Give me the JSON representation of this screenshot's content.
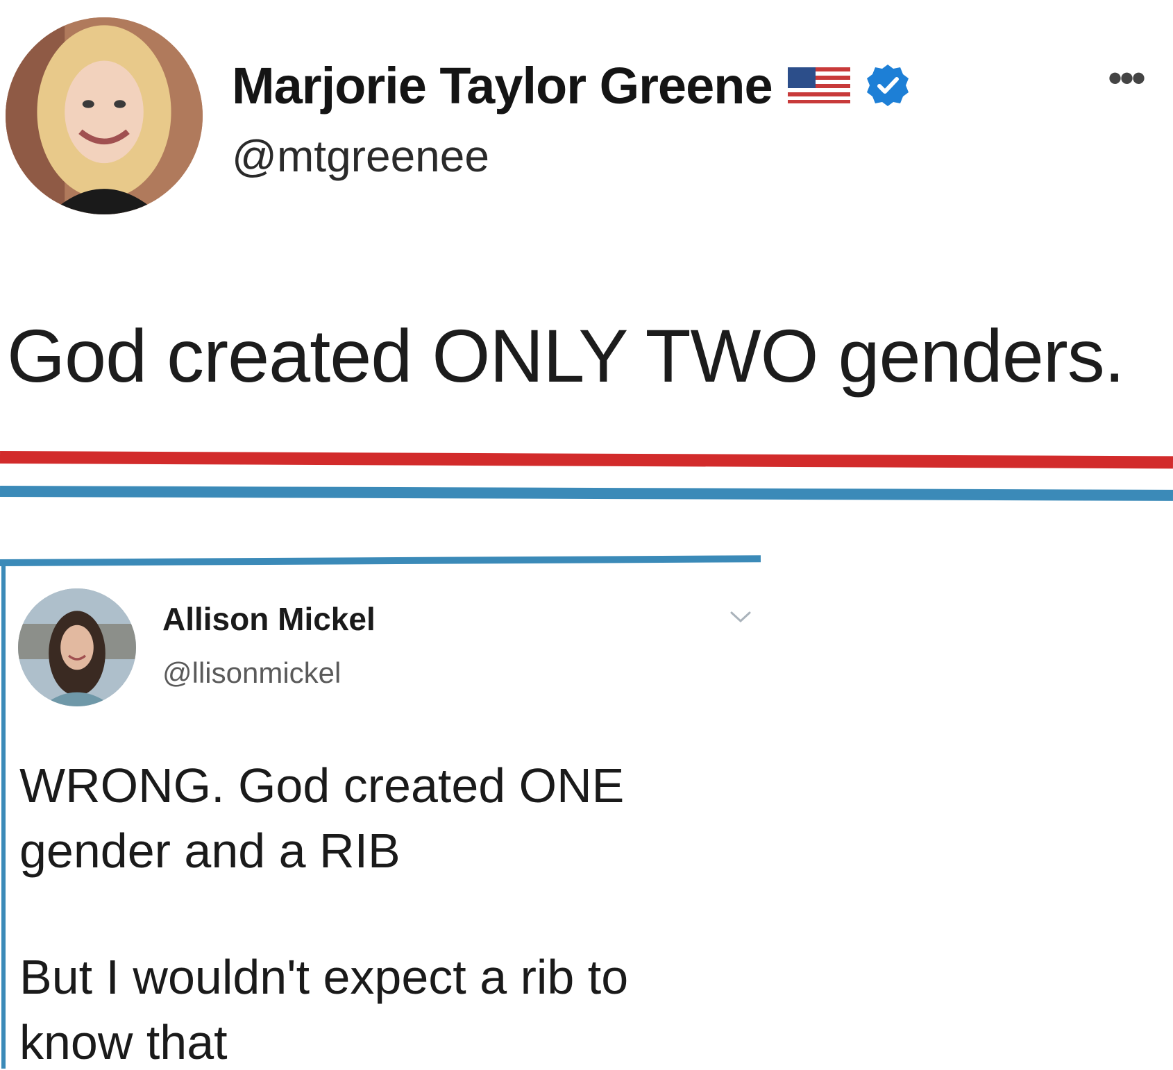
{
  "original_tweet": {
    "display_name": "Marjorie Taylor Greene",
    "handle": "@mtgreenee",
    "flag_icon": "us-flag-icon",
    "verified_icon": "verified-badge-icon",
    "more_label": "•••",
    "text": "God created ONLY TWO genders."
  },
  "separator": {
    "red": "#d22b2b",
    "blue": "#3b8ab8"
  },
  "reply_tweet": {
    "display_name": "Allison Mickel",
    "handle": "@llisonmickel",
    "text_lines": [
      "WRONG. God created ONE",
      "gender and a RIB",
      "But I wouldn't expect a rib to",
      "know that"
    ]
  },
  "colors": {
    "verified_blue": "#1d7fd6",
    "card_border": "#3b8ab8"
  }
}
